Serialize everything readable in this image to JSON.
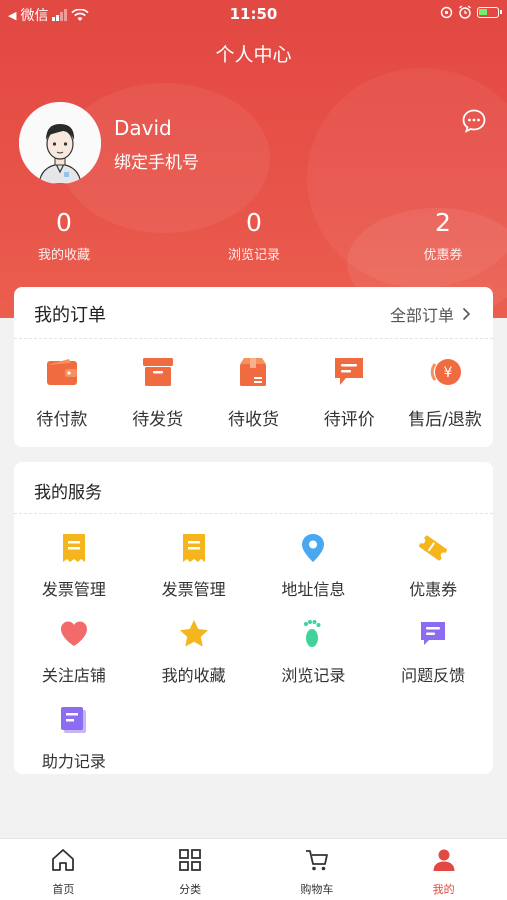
{
  "status_bar": {
    "carrier": "微信",
    "time": "11:50"
  },
  "header": {
    "title": "个人中心",
    "username": "David",
    "bind_phone": "绑定手机号"
  },
  "stats": [
    {
      "value": "0",
      "label": "我的收藏"
    },
    {
      "value": "0",
      "label": "浏览记录"
    },
    {
      "value": "2",
      "label": "优惠券"
    }
  ],
  "orders": {
    "title": "我的订单",
    "all_label": "全部订单",
    "items": [
      {
        "label": "待付款",
        "icon": "wallet-icon"
      },
      {
        "label": "待发货",
        "icon": "box-icon"
      },
      {
        "label": "待收货",
        "icon": "package-icon"
      },
      {
        "label": "待评价",
        "icon": "comment-icon"
      },
      {
        "label": "售后/退款",
        "icon": "refund-icon"
      }
    ]
  },
  "services": {
    "title": "我的服务",
    "items": [
      {
        "label": "发票管理",
        "icon": "invoice-icon"
      },
      {
        "label": "发票管理",
        "icon": "invoice-icon"
      },
      {
        "label": "地址信息",
        "icon": "location-pin-icon"
      },
      {
        "label": "优惠券",
        "icon": "coupon-icon"
      },
      {
        "label": "关注店铺",
        "icon": "heart-icon"
      },
      {
        "label": "我的收藏",
        "icon": "star-icon"
      },
      {
        "label": "浏览记录",
        "icon": "footprint-icon"
      },
      {
        "label": "问题反馈",
        "icon": "feedback-icon"
      },
      {
        "label": "助力记录",
        "icon": "help-record-icon"
      }
    ]
  },
  "tabbar": {
    "items": [
      {
        "label": "首页",
        "icon": "home-icon"
      },
      {
        "label": "分类",
        "icon": "grid-icon"
      },
      {
        "label": "购物车",
        "icon": "cart-icon"
      },
      {
        "label": "我的",
        "icon": "user-icon"
      }
    ],
    "active_index": 3
  },
  "colors": {
    "accent": "#e34943",
    "order_icon": "#f06b3f",
    "invoice": "#f5b51c",
    "location": "#4aa8f0",
    "heart": "#f36a6a",
    "star": "#f5b51c",
    "footprint": "#3fd39b",
    "feedback": "#8c6cf0"
  }
}
